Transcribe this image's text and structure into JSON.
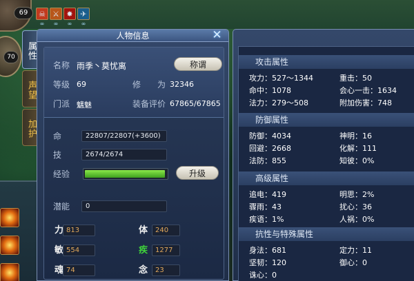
{
  "hud": {
    "player_level": "69",
    "pet_level": "70",
    "buffs": [
      {
        "icon": "skull-buff-icon",
        "glyph": "☠",
        "color": "#c23a1e",
        "duration": "∞"
      },
      {
        "icon": "sword-buff-icon",
        "glyph": "⚔",
        "color": "#b8571a",
        "duration": "∞"
      },
      {
        "icon": "blood-buff-icon",
        "glyph": "✸",
        "color": "#a3140e",
        "duration": "∞"
      },
      {
        "icon": "wind-buff-icon",
        "glyph": "✈",
        "color": "#1a5e8c",
        "duration": "∞"
      }
    ]
  },
  "tabs": [
    {
      "label": "属性",
      "active": true
    },
    {
      "label": "声望",
      "active": false
    },
    {
      "label": "加护",
      "active": false
    }
  ],
  "panel": {
    "title": "人物信息",
    "close_glyph": "✕",
    "name_label": "名称",
    "name_value": "雨季丶莫忧离",
    "title_button": "称谓",
    "level_label": "等级",
    "level_value": "69",
    "cultivation_label": "修",
    "cultivation_label2": "为",
    "cultivation_value": "32346",
    "sect_label": "门派",
    "sect_value": "魑魅",
    "gear_label": "装备评价",
    "gear_value": "67865/67865",
    "hp_label": "命",
    "hp_value": "22807/22807(+3600)",
    "skill_label": "技",
    "skill_value": "2674/2674",
    "exp_label": "经验",
    "exp_fraction": 0.98,
    "upgrade_button": "升级",
    "potential_label": "潜能",
    "potential_value": "0",
    "stats": [
      {
        "label": "力",
        "value": "813"
      },
      {
        "label": "体",
        "value": "240"
      },
      {
        "label": "敏",
        "value": "554"
      },
      {
        "label": "疾",
        "value": "1277",
        "label_color": "#3fd33a"
      },
      {
        "label": "魂",
        "value": "74"
      },
      {
        "label": "念",
        "value": "23"
      }
    ]
  },
  "attrs": {
    "attack_head": "攻击属性",
    "attack": {
      "r1c1": "攻力：527～1344",
      "r1c2": "重击：50",
      "r2c1": "命中：1078",
      "r2c2": "会心一击：1634",
      "r3c1": "法力：279～508",
      "r3c2": "附加伤害：748"
    },
    "defense_head": "防御属性",
    "defense": {
      "r1c1": "防御：4034",
      "r1c2": "神明：16",
      "r2c1": "回避：2668",
      "r2c2": "化解：111",
      "r3c1": "法防：855",
      "r3c2": "知彼：0%"
    },
    "advanced_head": "高级属性",
    "advanced": {
      "r1c1": "追电：419",
      "r1c2": "明思：2%",
      "r2c1": "骤雨：43",
      "r2c2": "扰心：36",
      "r3c1": "疾语：1%",
      "r3c2": "人祸：0%"
    },
    "resist_head": "抗性与特殊属性",
    "resist": {
      "r1c1": "身法：681",
      "r1c2": "定力：11",
      "r2c1": "坚韧：120",
      "r2c2": "御心：0",
      "r3c1": "诛心：0"
    }
  }
}
